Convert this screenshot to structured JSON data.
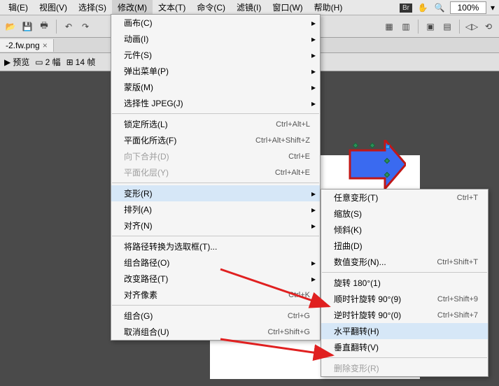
{
  "zoom": "100%",
  "menubar": [
    "辑(E)",
    "视图(V)",
    "选择(S)",
    "修改(M)",
    "文本(T)",
    "命令(C)",
    "滤镜(I)",
    "窗口(W)",
    "帮助(H)"
  ],
  "icons": {
    "br": "Br"
  },
  "tab": {
    "name": "-2.fw.png",
    "close": "×"
  },
  "subtoolbar": {
    "preview": "预览",
    "two": "2 幅",
    "four": "14 帧"
  },
  "menu1_groups": [
    [
      {
        "label": "画布(C)",
        "sub": true
      },
      {
        "label": "动画(I)",
        "sub": true
      },
      {
        "label": "元件(S)",
        "sub": true
      },
      {
        "label": "弹出菜单(P)",
        "sub": true
      },
      {
        "label": "蒙版(M)",
        "sub": true
      },
      {
        "label": "选择性 JPEG(J)",
        "sub": true
      }
    ],
    [
      {
        "label": "锁定所选(L)",
        "shortcut": "Ctrl+Alt+L"
      },
      {
        "label": "平面化所选(F)",
        "shortcut": "Ctrl+Alt+Shift+Z"
      },
      {
        "label": "向下合并(D)",
        "shortcut": "Ctrl+E",
        "disabled": true
      },
      {
        "label": "平面化层(Y)",
        "shortcut": "Ctrl+Alt+E",
        "disabled": true
      }
    ],
    [
      {
        "label": "变形(R)",
        "sub": true,
        "hover": true
      },
      {
        "label": "排列(A)",
        "sub": true
      },
      {
        "label": "对齐(N)",
        "sub": true
      }
    ],
    [
      {
        "label": "将路径转换为选取框(T)..."
      },
      {
        "label": "组合路径(O)",
        "sub": true
      },
      {
        "label": "改变路径(T)",
        "sub": true
      },
      {
        "label": "对齐像素",
        "shortcut": "Ctrl+K"
      }
    ],
    [
      {
        "label": "组合(G)",
        "shortcut": "Ctrl+G"
      },
      {
        "label": "取消组合(U)",
        "shortcut": "Ctrl+Shift+G"
      }
    ]
  ],
  "menu2_groups": [
    [
      {
        "label": "任意变形(T)",
        "shortcut": "Ctrl+T"
      },
      {
        "label": "缩放(S)"
      },
      {
        "label": "倾斜(K)"
      },
      {
        "label": "扭曲(D)"
      },
      {
        "label": "数值变形(N)...",
        "shortcut": "Ctrl+Shift+T"
      }
    ],
    [
      {
        "label": "旋转 180°(1)"
      },
      {
        "label": "顺时针旋转 90°(9)",
        "shortcut": "Ctrl+Shift+9"
      },
      {
        "label": "逆时针旋转 90°(0)",
        "shortcut": "Ctrl+Shift+7"
      },
      {
        "label": "水平翻转(H)",
        "hover": true
      },
      {
        "label": "垂直翻转(V)"
      }
    ],
    [
      {
        "label": "删除变形(R)",
        "disabled": true
      }
    ]
  ]
}
